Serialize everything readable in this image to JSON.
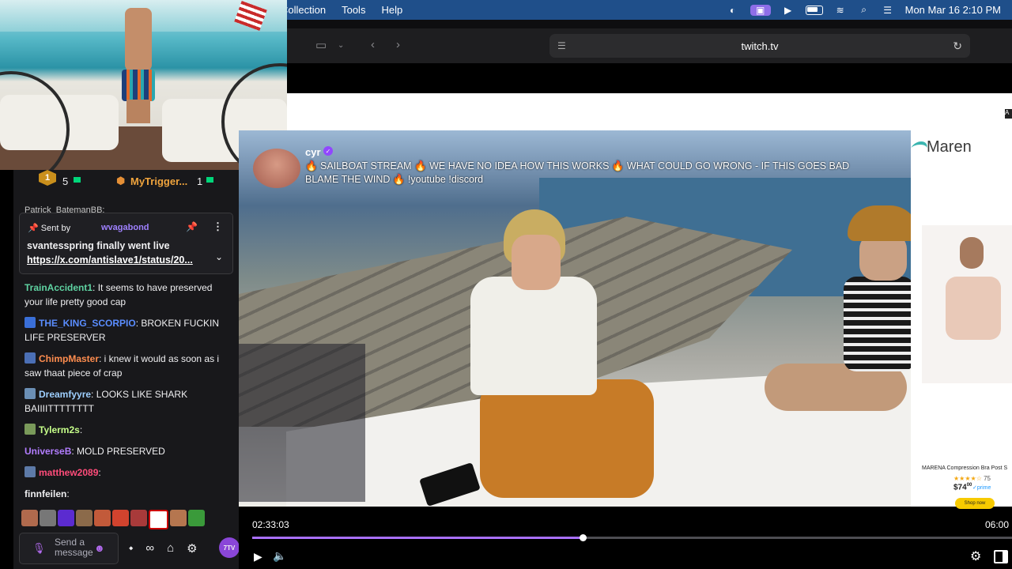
{
  "menubar": {
    "menus": [
      "Collection",
      "Tools",
      "Help"
    ],
    "datetime": "Mon Mar 16  2:10 PM"
  },
  "browser": {
    "url": "twitch.tv"
  },
  "hype_train": {
    "left_count": "5",
    "top_user": "MyTrigger...",
    "right_count": "1",
    "rank_badge": "1"
  },
  "chat": {
    "partial_name": "Patrick_BatemanBB:",
    "pinned": {
      "sent_by_label": "Sent by",
      "user": "wvagabond",
      "message": "svantesspring finally went live",
      "link": "https://x.com/antislave1/status/20..."
    },
    "messages": [
      {
        "name": "TrainAccident1",
        "name_color": "#5fd3a2",
        "text": ": It seems to have preserved your life pretty good cap",
        "badge": ""
      },
      {
        "name": "THE_KING_SCORPIO",
        "name_color": "#5a8dff",
        "text": ": BROKEN FUCKIN LIFE PRESERVER",
        "badge": "#3a6fd8"
      },
      {
        "name": "ChimpMaster",
        "name_color": "#ff8d4f",
        "text": ": i knew it would as soon as i saw thaat piece of crap",
        "badge": "#4b6fb5"
      },
      {
        "name": "Dreamfyyre",
        "name_color": "#9ecfff",
        "text": ": LOOKS LIKE SHARK BAIIIITTTTTTTT",
        "badge": "#6b8fb5"
      },
      {
        "name": "Tylerm2s",
        "name_color": "#c6ff8a",
        "text": ":",
        "badge": "#7a9a5a"
      },
      {
        "name": "UniverseB",
        "name_color": "#b27dff",
        "text": ": MOLD PRESERVED",
        "badge": ""
      },
      {
        "name": "matthew2089",
        "name_color": "#ff4c7a",
        "text": ":",
        "badge": "#5d7aa8"
      },
      {
        "name": "finnfeilen",
        "name_color": "#efeff1",
        "text": ":",
        "badge": ""
      }
    ],
    "input_placeholder": "Send a message",
    "seventv_label": "7TV"
  },
  "stream": {
    "streamer": "cyr",
    "title": "🔥 SAILBOAT STREAM 🔥 WE HAVE NO IDEA HOW THIS WORKS 🔥 WHAT COULD GO WRONG - IF THIS GOES BAD BLAME THE WIND 🔥 !youtube !discord"
  },
  "player": {
    "current_time": "02:33:03",
    "end_time": "06:00",
    "progress": 0.435
  },
  "ad": {
    "brand": "Maren",
    "product_name": "MARENA Compression Bra Post S",
    "stars": "★★★★☆",
    "rating_count": "75",
    "price": "$74",
    "price_cents": "00",
    "prime": "✓prime",
    "cta": "Shop now"
  },
  "colors": {
    "twitch_purple": "#9147ff",
    "menubar_blue": "#1f4f8a",
    "chat_bg": "#18181b"
  }
}
